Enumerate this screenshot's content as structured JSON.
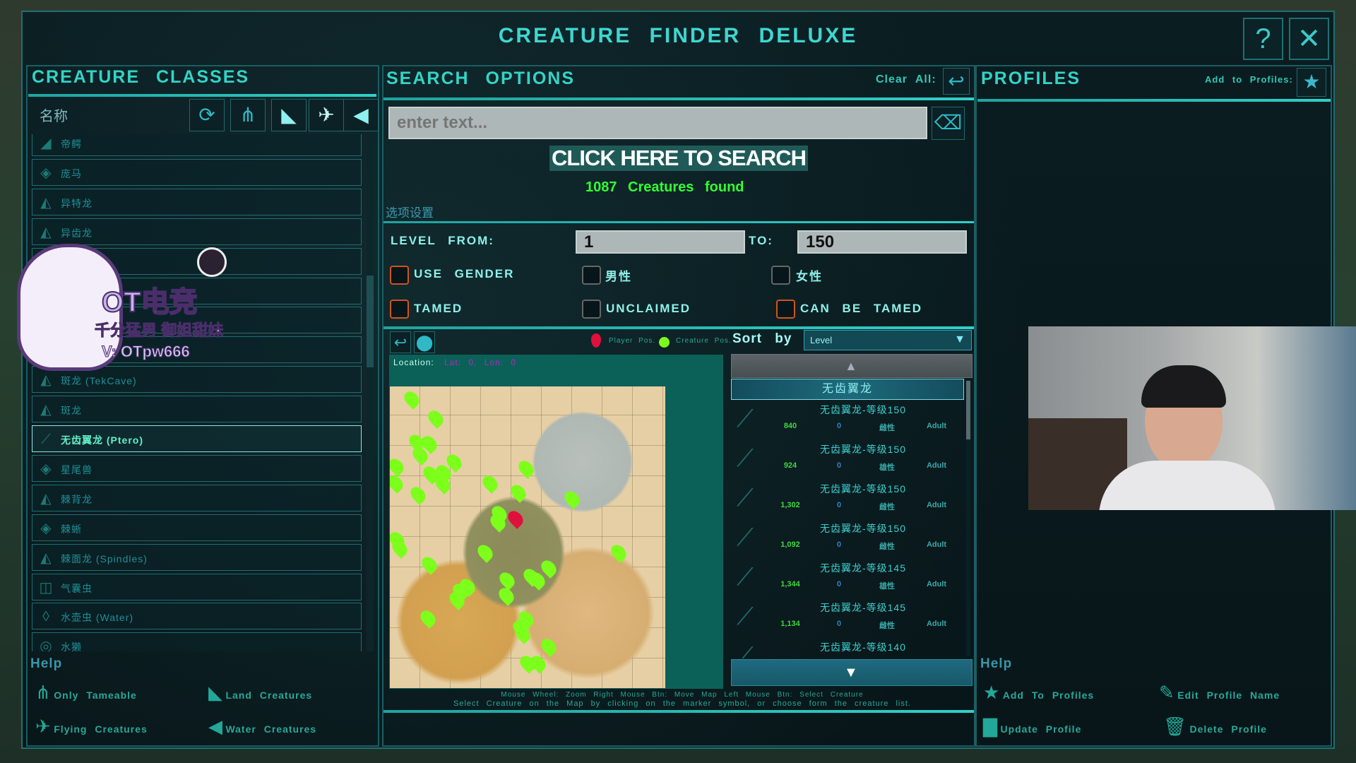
{
  "window": {
    "title": "CREATURE FINDER DELUXE",
    "help_label": "?",
    "close_label": "✕"
  },
  "left": {
    "title": "CREATURE CLASSES",
    "name_label": "名称",
    "filter_icons": [
      "refresh-icon",
      "footprint-icon",
      "dino-head-icon",
      "bird-icon",
      "fish-icon"
    ],
    "items": [
      {
        "label": "帝鳄"
      },
      {
        "label": "庞马"
      },
      {
        "label": "异特龙"
      },
      {
        "label": "异齿龙"
      },
      {
        "label": ""
      },
      {
        "label": ""
      },
      {
        "label": ""
      },
      {
        "label": ""
      },
      {
        "label": "斑龙 (TekCave)"
      },
      {
        "label": "斑龙"
      },
      {
        "label": "无齿翼龙 (Ptero)",
        "selected": true
      },
      {
        "label": "星尾兽"
      },
      {
        "label": "棘背龙"
      },
      {
        "label": "棘蜥"
      },
      {
        "label": "棘面龙 (Spindles)"
      },
      {
        "label": "气囊虫"
      },
      {
        "label": "水壶虫 (Water)"
      },
      {
        "label": "水獭"
      }
    ],
    "help_title": "Help",
    "help": {
      "only_tameable": "Only Tameable",
      "land": "Land Creatures",
      "flying": "Flying Creatures",
      "water": "Water Creatures"
    }
  },
  "sticker": {
    "brand": "OT电竞",
    "slogan": "千分猛男 御姐甜妹",
    "contact": "V: OTpw666"
  },
  "search": {
    "title": "SEARCH OPTIONS",
    "clear_all": "Clear All:",
    "input_value": "",
    "input_placeholder": "enter text...",
    "search_button": "CLICK HERE TO SEARCH",
    "found_text": "1087 Creatures found",
    "options_label": "选项设置",
    "level_from_label": "LEVEL FROM:",
    "level_from": "1",
    "level_to_label": "TO:",
    "level_to": "150",
    "checks": {
      "use_gender": "USE GENDER",
      "male": "男性",
      "female": "女性",
      "tamed": "TAMED",
      "unclaimed": "UNCLAIMED",
      "can_be_tamed": "CAN BE TAMED"
    }
  },
  "map": {
    "player_pos": "Player Pos.",
    "creature_pos": "Creature Pos.",
    "location_label": "Location:",
    "location_value": "Lat: 0, Lon: 0",
    "hint1": "Mouse Wheel: Zoom   Right Mouse Btn: Move Map   Left Mouse Btn: Select Creature",
    "hint2": "Select Creature on the Map by clicking on the marker symbol, or choose form the creature list."
  },
  "results": {
    "sort_label": "Sort by",
    "sort_value": "Level",
    "group_header": "无齿翼龙",
    "rows": [
      {
        "name": "无齿翼龙-等级150",
        "distance": "840",
        "count": "0",
        "gender": "雌性",
        "age": "Adult"
      },
      {
        "name": "无齿翼龙-等级150",
        "distance": "924",
        "count": "0",
        "gender": "雄性",
        "age": "Adult"
      },
      {
        "name": "无齿翼龙-等级150",
        "distance": "1,302",
        "count": "0",
        "gender": "雌性",
        "age": "Adult"
      },
      {
        "name": "无齿翼龙-等级150",
        "distance": "1,092",
        "count": "0",
        "gender": "雌性",
        "age": "Adult"
      },
      {
        "name": "无齿翼龙-等级145",
        "distance": "1,344",
        "count": "0",
        "gender": "雄性",
        "age": "Adult"
      },
      {
        "name": "无齿翼龙-等级145",
        "distance": "1,134",
        "count": "0",
        "gender": "雌性",
        "age": "Adult"
      },
      {
        "name": "无齿翼龙-等级140",
        "distance": "",
        "count": "",
        "gender": "",
        "age": ""
      }
    ]
  },
  "profiles": {
    "title": "PROFILES",
    "add_label": "Add to Profiles:",
    "help_title": "Help",
    "help": {
      "add": "Add To Profiles",
      "edit": "Edit Profile Name",
      "update": "Update Profile",
      "delete": "Delete Profile"
    }
  },
  "colors": {
    "accent": "#33d4c6",
    "found": "#33ff33",
    "checkbox_active": "#d0541c",
    "player_pin": "#e0103c",
    "creature_pin": "#7cff1a",
    "location": "#c020c0"
  }
}
